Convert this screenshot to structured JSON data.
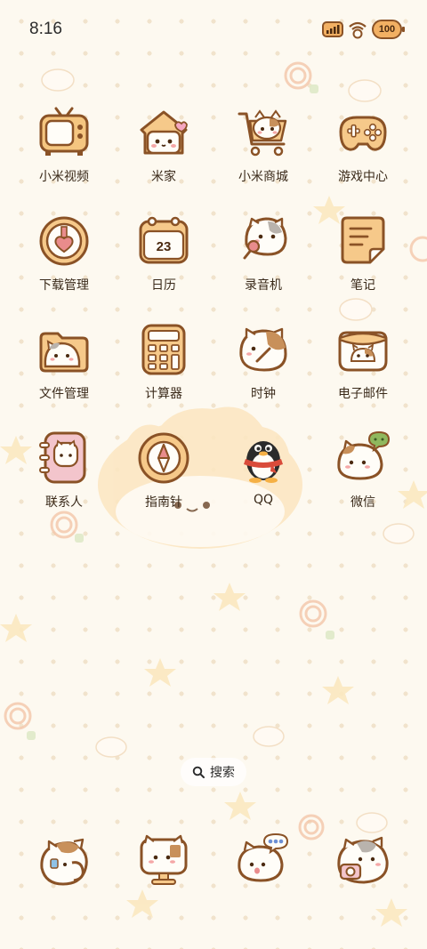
{
  "status_bar": {
    "time": "8:16",
    "battery": "100"
  },
  "apps": [
    {
      "label": "小米视频",
      "icon": "tv-icon"
    },
    {
      "label": "米家",
      "icon": "cat-house-icon"
    },
    {
      "label": "小米商城",
      "icon": "cat-cart-icon"
    },
    {
      "label": "游戏中心",
      "icon": "gamepad-icon"
    },
    {
      "label": "下载管理",
      "icon": "download-heart-icon"
    },
    {
      "label": "日历",
      "icon": "calendar-icon",
      "calendar_day": "23"
    },
    {
      "label": "录音机",
      "icon": "cat-microphone-icon"
    },
    {
      "label": "笔记",
      "icon": "notes-icon"
    },
    {
      "label": "文件管理",
      "icon": "cat-folder-icon"
    },
    {
      "label": "计算器",
      "icon": "calculator-icon"
    },
    {
      "label": "时钟",
      "icon": "cat-clock-icon"
    },
    {
      "label": "电子邮件",
      "icon": "cat-envelope-icon"
    },
    {
      "label": "联系人",
      "icon": "cat-contacts-icon"
    },
    {
      "label": "指南针",
      "icon": "compass-icon"
    },
    {
      "label": "QQ",
      "icon": "qq-penguin-icon"
    },
    {
      "label": "微信",
      "icon": "cat-wechat-icon"
    }
  ],
  "search": {
    "label": "搜索"
  },
  "dock": [
    {
      "name": "phone",
      "icon": "cat-phone-icon"
    },
    {
      "name": "browser",
      "icon": "cat-monitor-icon"
    },
    {
      "name": "messages",
      "icon": "cat-message-icon"
    },
    {
      "name": "camera",
      "icon": "cat-camera-icon"
    }
  ],
  "colors": {
    "background": "#fdf9f0",
    "dot": "#f1e3cc",
    "icon_fill": "#fbd9a6",
    "icon_outline": "#8a5226",
    "cat_white": "#fffdf8"
  }
}
